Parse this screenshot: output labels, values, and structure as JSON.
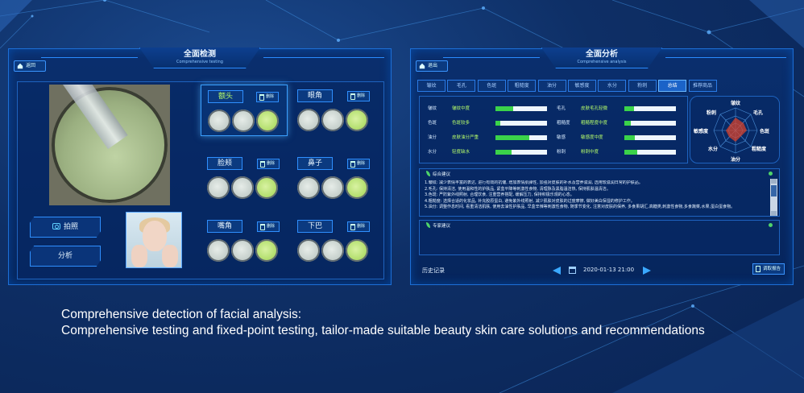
{
  "left": {
    "title": "全面检测",
    "subtitle": "Comprehensive testing",
    "back_label": "返回",
    "delete_label": "删除",
    "photo_label": "拍照",
    "analyze_label": "分析",
    "zones": [
      {
        "label": "额头",
        "active": true,
        "thumbs": [
          "gray",
          "gray",
          "green"
        ]
      },
      {
        "label": "眼角",
        "active": false,
        "thumbs": [
          "gray",
          "gray",
          "green"
        ]
      },
      {
        "label": "脸颊",
        "active": false,
        "thumbs": [
          "gray",
          "gray",
          "green"
        ]
      },
      {
        "label": "鼻子",
        "active": false,
        "thumbs": [
          "gray",
          "gray",
          "green"
        ]
      },
      {
        "label": "嘴角",
        "active": false,
        "thumbs": [
          "gray",
          "gray",
          "green"
        ]
      },
      {
        "label": "下巴",
        "active": false,
        "thumbs": [
          "gray",
          "gray",
          "green"
        ]
      }
    ]
  },
  "right": {
    "title": "全面分析",
    "subtitle": "Comprehensive analysis",
    "back_label": "退出",
    "tabs": [
      "皱纹",
      "毛孔",
      "色斑",
      "粗糙度",
      "油分",
      "敏感度",
      "水分",
      "粉刺",
      "总结",
      "推荐商品"
    ],
    "active_tab": "总结",
    "metrics": [
      {
        "name": "皱纹",
        "level": "皱纹中度",
        "value": 0.35
      },
      {
        "name": "毛孔",
        "level": "皮肤毛孔轻微",
        "value": 0.18
      },
      {
        "name": "色斑",
        "level": "色斑较多",
        "value": 0.1
      },
      {
        "name": "粗糙度",
        "level": "粗糙程度中度",
        "value": 0.12
      },
      {
        "name": "油分",
        "level": "皮肤油分严重",
        "value": 0.65
      },
      {
        "name": "敏感",
        "level": "敏感度中度",
        "value": 0.2
      },
      {
        "name": "水分",
        "level": "轻度缺水",
        "value": 0.32
      },
      {
        "name": "粉刺",
        "level": "粉刺中度",
        "value": 0.25
      }
    ],
    "radar_labels": [
      "皱纹",
      "毛孔",
      "色斑",
      "粗糙度",
      "油分",
      "水分",
      "敏感度",
      "粉刺"
    ],
    "advice_title": "综合建议",
    "advice_lines": [
      "1.皱纹: 减少表情丰富的表达, 进行有效的抗皱, 增加表情肌弹性, 加强对皮肤的补水及营养滋润, 选用较滋润日常的护肤品。",
      "2.毛孔: 保持清洁, 使用温和性的护肤品, 紧盒平降等刺激性食物, 清理脉及黑脂温洁热, 保持肌肤温清洁。",
      "3.色斑: 严防紫外线照射, 合理饮食, 注重营养搭配, 缓解压力, 保持积极乐观的心态。",
      "4.粗糙度: 选择合适的化妆品, 补充胶原蛋白, 避免紫外线照射, 减少肌肤对皮肤的过度摩擦, 做好美白保湿的修护工作。",
      "5.油分: 调整作息时间, 看重清洁肌肤, 使用去油性护肤品, 早盒辛辣等刺激性食物, 随季节变化, 注意对皮肤的保养, 多食果胡汇,高糖类,刺激性食物,多食蔬菜,水果,蛋白蛋食物。"
    ],
    "expert_title": "专家建议",
    "history_label": "历史记录",
    "date": "2020-01-13 21:00",
    "report_label": "调取报告"
  },
  "caption": {
    "line1": "Comprehensive detection of facial analysis:",
    "line2": "Comprehensive testing and fixed-point testing, tailor-made suitable beauty skin care solutions and recommendations"
  },
  "colors": {
    "accent": "#2a8cff",
    "good": "#3bd34a",
    "highlight": "#b8ff6a"
  }
}
